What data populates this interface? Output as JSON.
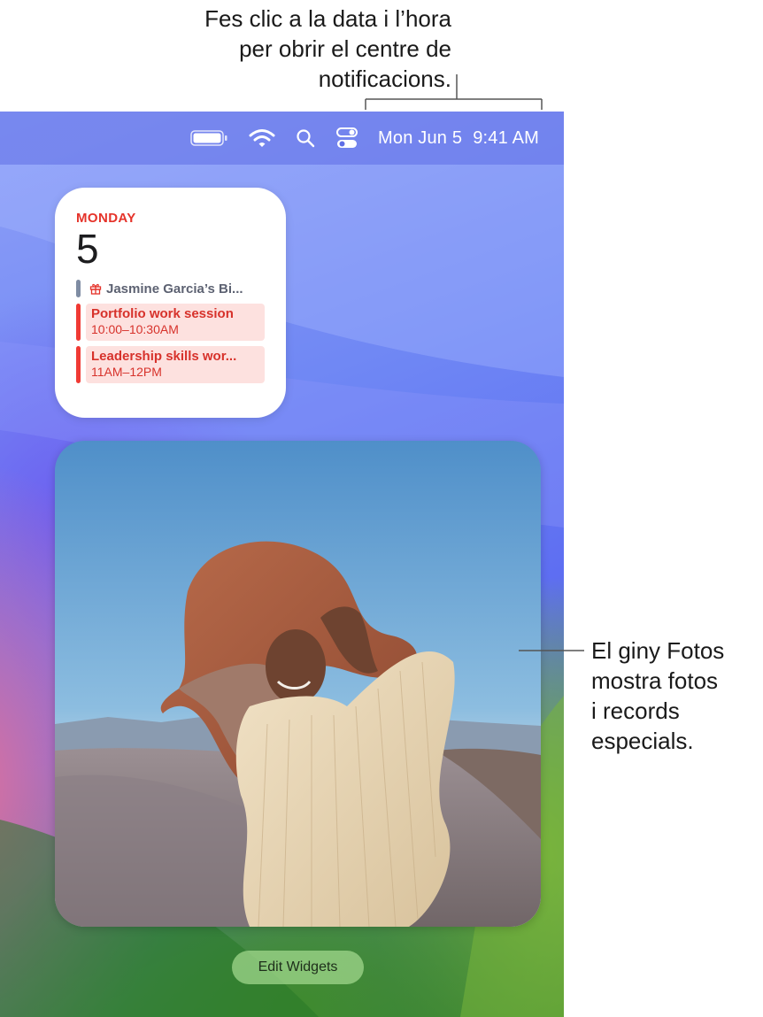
{
  "callouts": {
    "top": [
      "Fes clic a la data i l’hora",
      "per obrir el centre de",
      "notificacions."
    ],
    "right": [
      "El giny Fotos",
      "mostra fotos",
      "i records",
      "especials."
    ]
  },
  "menubar": {
    "icons": [
      "battery-icon",
      "wifi-icon",
      "search-icon",
      "control-center-icon"
    ],
    "date": "Mon Jun 5",
    "time": "9:41 AM"
  },
  "calendar_widget": {
    "day": "MONDAY",
    "date": "5",
    "all_day_event": "Jasmine Garcia’s Bi...",
    "events": [
      {
        "title": "Portfolio work session",
        "time": "10:00–10:30AM"
      },
      {
        "title": "Leadership skills wor...",
        "time": "11AM–12PM"
      }
    ],
    "colors": {
      "accent": "#e5332a",
      "event_bg": "#fde1df",
      "all_day_bar": "#7f8ca3"
    }
  },
  "photos_widget": {
    "content": "portrait-photo"
  },
  "edit_widgets_label": "Edit Widgets"
}
